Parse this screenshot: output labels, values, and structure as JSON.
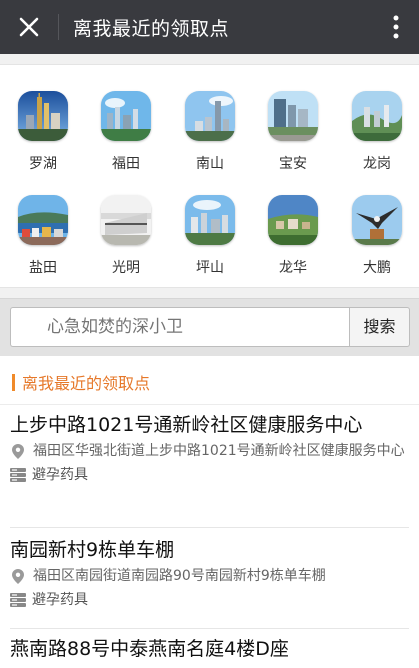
{
  "header": {
    "title": "离我最近的领取点",
    "close_icon": "close-icon",
    "more_icon": "more-vertical-icon"
  },
  "districts": [
    {
      "label": "罗湖",
      "icon": "luohu-skyline-icon"
    },
    {
      "label": "福田",
      "icon": "futian-skyline-icon"
    },
    {
      "label": "南山",
      "icon": "nanshan-skyline-icon"
    },
    {
      "label": "宝安",
      "icon": "baoan-skyline-icon"
    },
    {
      "label": "龙岗",
      "icon": "longgang-skyline-icon"
    },
    {
      "label": "盐田",
      "icon": "yantian-harbor-icon"
    },
    {
      "label": "光明",
      "icon": "guangming-gate-icon"
    },
    {
      "label": "坪山",
      "icon": "pingshan-city-icon"
    },
    {
      "label": "龙华",
      "icon": "longhua-town-icon"
    },
    {
      "label": "大鹏",
      "icon": "dapeng-eagle-icon"
    }
  ],
  "search": {
    "placeholder": "心急如焚的深小卫",
    "button": "搜索"
  },
  "section": {
    "title": "离我最近的领取点"
  },
  "sites": [
    {
      "name": "上步中路1021号通新岭社区健康服务中心",
      "address": "福田区华强北街道上步中路1021号通新岭社区健康服务中心",
      "tag": "避孕药具"
    },
    {
      "name": "南园新村9栋单车棚",
      "address": "福田区南园街道南园路90号南园新村9栋单车棚",
      "tag": "避孕药具"
    },
    {
      "name": "燕南路88号中泰燕南名庭4楼D座"
    }
  ],
  "colors": {
    "topbar": "#393a3f",
    "accent": "#f08a2a",
    "section_text": "#e6782a"
  }
}
